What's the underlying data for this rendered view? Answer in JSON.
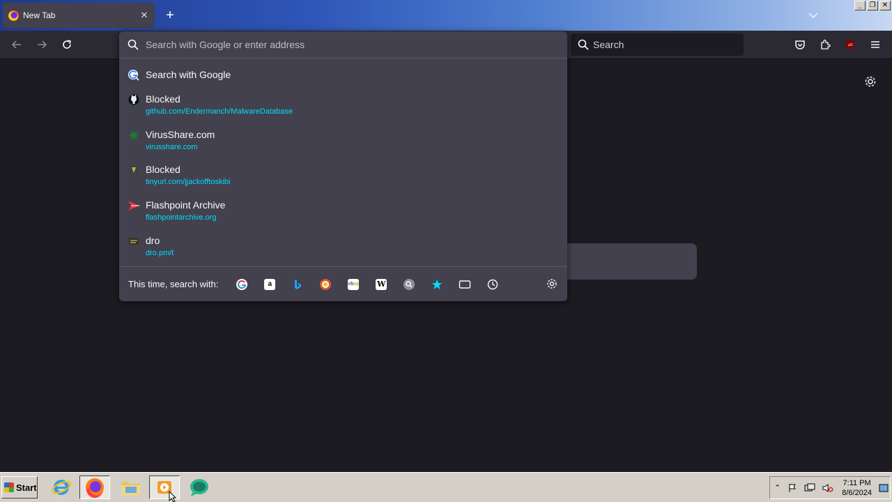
{
  "tab": {
    "title": "New Tab",
    "close": "✕"
  },
  "newtab": {
    "label": "+"
  },
  "window_controls": [
    "_",
    "❐",
    "✕"
  ],
  "toolbar": {
    "search_label": "Search"
  },
  "urlbar": {
    "placeholder": "Search with Google or enter address",
    "results": [
      {
        "title": "Search with Google",
        "url": "",
        "icon": "google-search-icon"
      },
      {
        "title": "Blocked",
        "url": "github.com/Endermanch/MalwareDatabase",
        "icon": "github-icon"
      },
      {
        "title": "VirusShare.com",
        "url": "virusshare.com",
        "icon": "virusshare-icon"
      },
      {
        "title": "Blocked",
        "url": "tinyurl.com/jjackofftoskibi",
        "icon": "tinyurl-icon"
      },
      {
        "title": "Flashpoint Archive",
        "url": "flashpointarchive.org",
        "icon": "flashpoint-icon"
      },
      {
        "title": "dro",
        "url": "dro.pm/t",
        "icon": "dro-icon"
      }
    ],
    "oneoff_label": "This time, search with:",
    "engines": [
      {
        "name": "google-engine-icon"
      },
      {
        "name": "amazon-engine-icon"
      },
      {
        "name": "bing-engine-icon"
      },
      {
        "name": "duckduckgo-engine-icon"
      },
      {
        "name": "ebay-engine-icon"
      },
      {
        "name": "wikipedia-engine-icon"
      },
      {
        "name": "search-engine-icon"
      },
      {
        "name": "bookmarks-icon"
      },
      {
        "name": "tabs-icon"
      },
      {
        "name": "history-icon"
      }
    ]
  },
  "taskbar": {
    "start_label": "Start",
    "clock_time": "7:11 PM",
    "clock_date": "8/6/2024"
  },
  "colors": {
    "accent_url": "#00ddff",
    "panel_bg": "#42414d",
    "page_bg": "#1c1b22"
  }
}
